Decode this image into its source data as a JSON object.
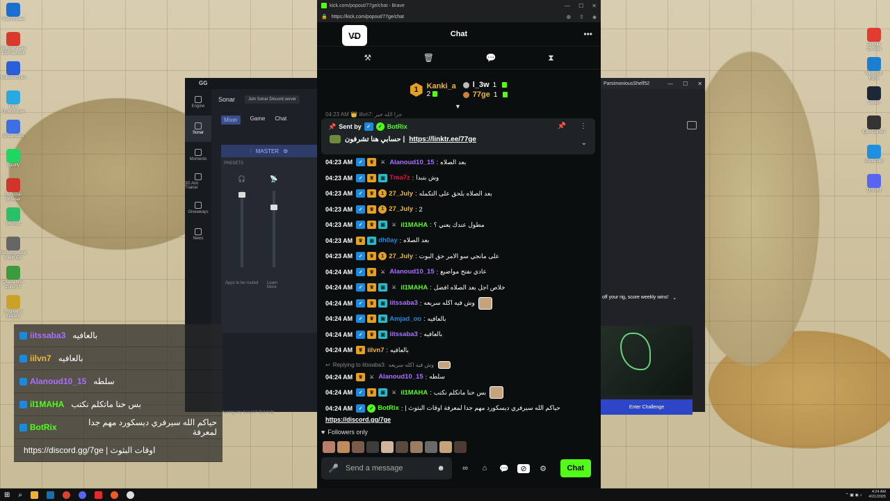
{
  "browser": {
    "tab_title": "kick.com/popout/77ge/chat - Brave",
    "url": "https://kick.com/popout/77ge/chat"
  },
  "chat": {
    "title": "Chat",
    "channel_logo": "V̶D",
    "cut_line": "04:23 AM 👑 iilvn7: جزا الله خير"
  },
  "leaderboard": {
    "first": {
      "name": "Kanki_a",
      "count": "2",
      "rank": "1"
    },
    "second": {
      "name": "l_3w",
      "count": "1"
    },
    "third": {
      "name": "77ge",
      "count": "1"
    }
  },
  "pinned": {
    "sent_by": "Sent by",
    "bot": "BotRix",
    "text": "حسابي هنا تشرفون |",
    "link": "https://linktr.ee/77ge"
  },
  "messages": [
    {
      "time": "04:23 AM",
      "badges": [
        "verified",
        "crown",
        "sword"
      ],
      "user": "Alanoud10_15",
      "color": "#a970ff",
      "text": "بعد الصلاه"
    },
    {
      "time": "04:23 AM",
      "badges": [
        "verified",
        "crown",
        "gift"
      ],
      "user": "Tma7z",
      "color": "#e9113c",
      "text": "وش بتبدا"
    },
    {
      "time": "04:23 AM",
      "badges": [
        "verified",
        "crown",
        "one"
      ],
      "user": "27_July",
      "color": "#f0b735",
      "text": "بعد الصلاه بلحق على التكمله"
    },
    {
      "time": "04:23 AM",
      "badges": [
        "verified",
        "crown",
        "one"
      ],
      "user": "27_July",
      "color": "#f0b735",
      "text": "2"
    },
    {
      "time": "04:23 AM",
      "badges": [
        "verified",
        "crown",
        "gift",
        "sword"
      ],
      "user": "il1MAHA",
      "color": "#53fc18",
      "text": "مطول عندك يعني ؟"
    },
    {
      "time": "04:23 AM",
      "badges": [
        "crown",
        "gift"
      ],
      "user": "dh0ay",
      "color": "#1e89d9",
      "text": "بعد الصلاه"
    },
    {
      "time": "04:23 AM",
      "badges": [
        "verified",
        "crown",
        "one"
      ],
      "user": "27_July",
      "color": "#f0b735",
      "text": "على مانجي سو الامر حق البوت"
    },
    {
      "time": "04:24 AM",
      "badges": [
        "verified",
        "crown",
        "sword"
      ],
      "user": "Alanoud10_15",
      "color": "#a970ff",
      "text": "عادي نفتح مواضيع"
    },
    {
      "time": "04:24 AM",
      "badges": [
        "verified",
        "crown",
        "gift",
        "sword"
      ],
      "user": "il1MAHA",
      "color": "#53fc18",
      "text": "خلاص اجل بعد الصلاه افضل"
    },
    {
      "time": "04:24 AM",
      "badges": [
        "verified",
        "crown",
        "gift"
      ],
      "user": "iitssaba3",
      "color": "#a970ff",
      "text": "وش فيه اكله سريعه",
      "emote": true
    },
    {
      "time": "04:24 AM",
      "badges": [
        "verified",
        "crown",
        "gift"
      ],
      "user": "Amjad_oo",
      "color": "#1e89d9",
      "text": "بالعافيه"
    },
    {
      "time": "04:24 AM",
      "badges": [
        "verified",
        "crown",
        "gift"
      ],
      "user": "iitssaba3",
      "color": "#a970ff",
      "text": "بالعافيه"
    },
    {
      "time": "04:24 AM",
      "badges": [
        "crown"
      ],
      "user": "iilvn7",
      "color": "#f0b735",
      "text": "بالعافيه"
    }
  ],
  "reply": {
    "label": "Replying to iitssaba3:",
    "quoted": "وش فيه اكله سريعه"
  },
  "after_reply": [
    {
      "time": "04:24 AM",
      "badges": [
        "crown",
        "sword"
      ],
      "user": "Alanoud10_15",
      "color": "#a970ff",
      "text": "سلطه"
    },
    {
      "time": "04:24 AM",
      "badges": [
        "verified",
        "crown",
        "gift",
        "sword"
      ],
      "user": "il1MAHA",
      "color": "#53fc18",
      "text": "بس حنا ماتكلم نكتب",
      "emote": true
    },
    {
      "time": "04:24 AM",
      "badges": [
        "verified",
        "bot"
      ],
      "user": "BotRix",
      "color": "#53fc18",
      "text": "حياكم الله سيرفري ديسكورد مهم جدا لمعرفة اوقات البثوث |"
    }
  ],
  "bot_link": "https://discord.gg/7ge",
  "followers_only": "Followers only",
  "composer": {
    "placeholder": "Send a message",
    "send": "Chat"
  },
  "gg": {
    "title": "GG",
    "section": "Sonar",
    "discord_btn": "Join Sonar Discord server",
    "tabs": [
      "Mixer",
      "Game",
      "Chat"
    ],
    "master": "MASTER",
    "presets": "PRESETS",
    "sidebar": [
      "Engine",
      "Sonar",
      "Moments",
      "3D Aim Trainer",
      "Giveaways",
      "News"
    ],
    "help": "Having any issues? Get help",
    "apps": "Apps to be routed",
    "learn": "Learn More"
  },
  "overlay": [
    {
      "user": "iitssaba3",
      "color": "#a970ff",
      "text": "بالعافيه"
    },
    {
      "user": "iilvn7",
      "color": "#f0b735",
      "text": "بالعافيه"
    },
    {
      "user": "Alanoud10_15",
      "color": "#a970ff",
      "text": "سلطه"
    },
    {
      "user": "il1MAHA",
      "color": "#53fc18",
      "text": "بس حنا ماتكلم نكتب"
    },
    {
      "user": "BotRix",
      "color": "#53fc18",
      "text": "حياكم الله سيرفري ديسكورد مهم جدا لمعرفة"
    },
    {
      "user": "",
      "color": "#fff",
      "text": "اوقات البثوث | https://discord.gg/7ge"
    }
  ],
  "pars": {
    "title": "ParsimoniousShelf52",
    "promo": "off your rig, score weekly wins!",
    "button": "Enter Challenge"
  },
  "taskbar": {
    "time": "4:24 AM",
    "date": "4/21/2025"
  },
  "desktop_left": [
    "TeamViewer",
    "Wondershare PDFelement",
    "Malwarebytes",
    "Free Downloader",
    "Streamlabs",
    "Spotify",
    "Personal Browser",
    "Wemod",
    "Gettinggoodat it with Ele",
    "Quarantine Zone Th",
    "Hogwarts Legacy"
  ],
  "desktop_right": [
    "Google Chrome",
    "Microsoft Edge",
    "Steam",
    "Epic Games",
    "Battle.net",
    "Discord"
  ],
  "colors": {
    "kick_green": "#53fc18",
    "gold": "#f0b735",
    "purple": "#a970ff",
    "blue": "#1e89d9"
  }
}
